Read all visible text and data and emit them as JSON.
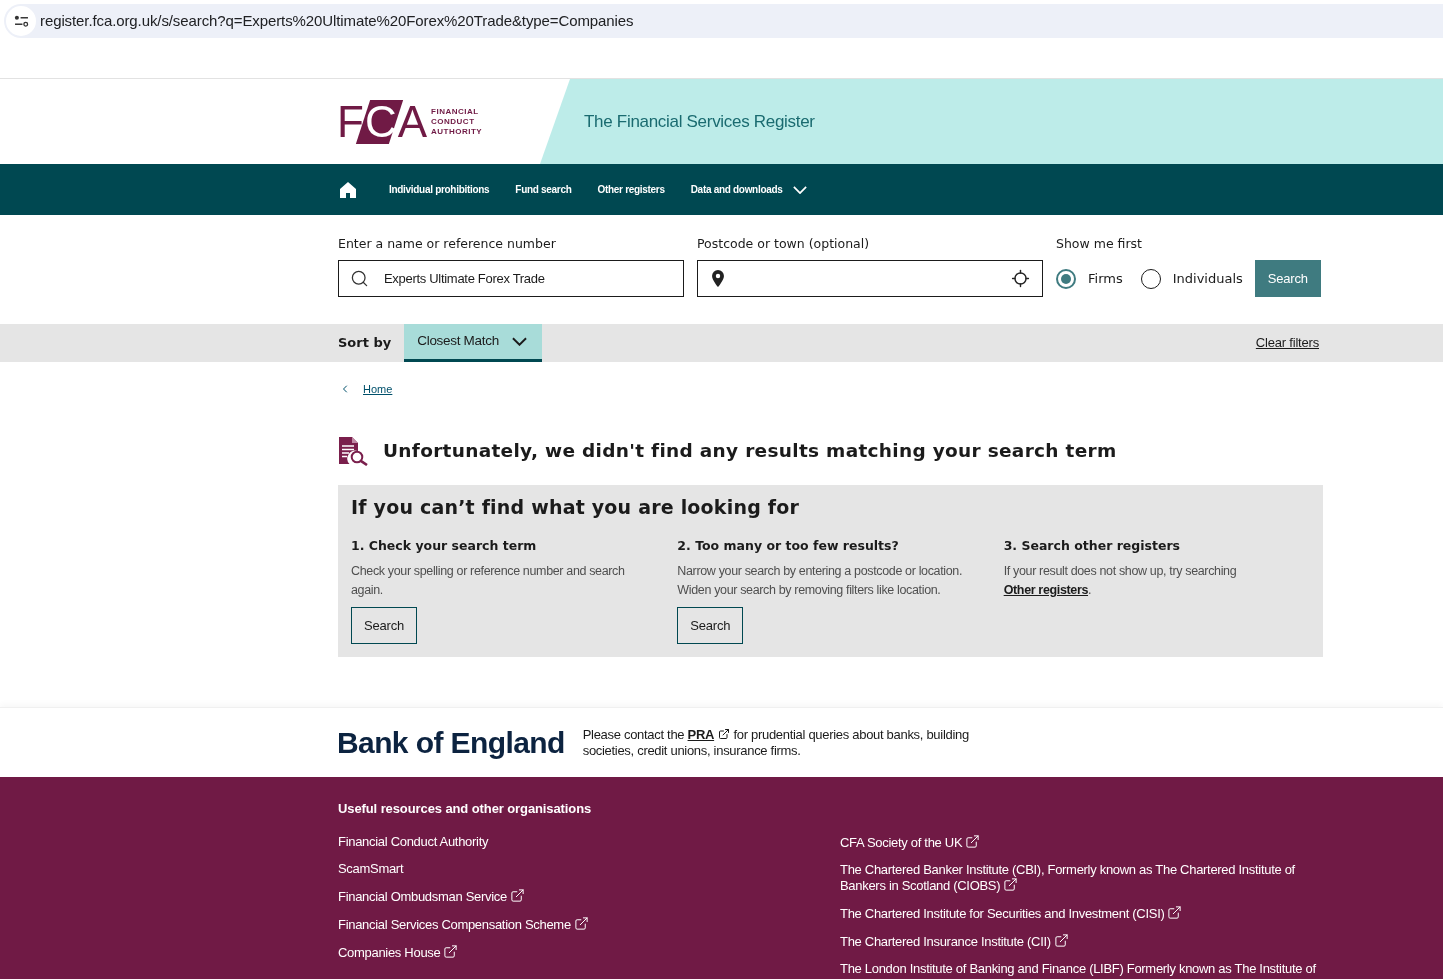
{
  "browser": {
    "url": "register.fca.org.uk/s/search?q=Experts%20Ultimate%20Forex%20Trade&type=Companies"
  },
  "header": {
    "logo": {
      "mark": "FCA",
      "name_lines": [
        "FINANCIAL",
        "CONDUCT",
        "AUTHORITY"
      ]
    },
    "title": "The Financial Services Register"
  },
  "nav": {
    "items": [
      {
        "label": "Individual prohibitions",
        "kind": "link"
      },
      {
        "label": "Fund search",
        "kind": "link"
      },
      {
        "label": "Other registers",
        "kind": "link"
      },
      {
        "label": "Data and downloads",
        "kind": "menu"
      }
    ]
  },
  "search": {
    "name_field": {
      "label": "Enter a name or reference number",
      "value": "Experts Ultimate Forex Trade"
    },
    "location_field": {
      "label": "Postcode or town (optional)"
    },
    "show_first": {
      "label": "Show me first",
      "options": [
        {
          "label": "Firms",
          "selected": true
        },
        {
          "label": "Individuals",
          "selected": false
        }
      ]
    },
    "button": "Search"
  },
  "sort_bar": {
    "label": "Sort by",
    "value": "Closest Match",
    "clear_filters": "Clear filters"
  },
  "breadcrumb": [
    "Home"
  ],
  "no_results": {
    "heading": "Unfortunately, we didn't find any results matching your search term"
  },
  "help_box": {
    "title": "If you can’t find what you are looking for",
    "columns": [
      {
        "heading": "1. Check your search term",
        "text": "Check your spelling or reference number and search again.",
        "button": "Search"
      },
      {
        "heading": "2. Too many or too few results?",
        "text": "Narrow your search by entering a postcode or location. Widen your search by removing filters like location.",
        "button": "Search"
      },
      {
        "heading": "3. Search other registers",
        "text": "If your result does not show up, try searching",
        "link": "Other registers",
        "text_end": "."
      }
    ]
  },
  "bank_of_england": {
    "logo": "Bank of England",
    "text_before": "Please contact the",
    "link": "PRA",
    "text_after": "for prudential queries about banks, building societies, credit unions, insurance firms."
  },
  "footer": {
    "title": "Useful resources and other organisations",
    "columns": [
      [
        {
          "label": "Financial Conduct Authority",
          "kind": "plain"
        },
        {
          "label": "ScamSmart",
          "kind": "plain"
        },
        {
          "label": "Financial Ombudsman Service",
          "kind": "external"
        },
        {
          "label": "Financial Services Compensation Scheme",
          "kind": "external"
        },
        {
          "label": "Companies House",
          "kind": "external"
        }
      ],
      [
        {
          "label": "CFA Society of the UK",
          "kind": "external"
        },
        {
          "label": "The Chartered Banker Institute (CBI), Formerly known as The Chartered Institute of Bankers in Scotland (CIOBS)",
          "kind": "external"
        },
        {
          "label": "The Chartered Institute for Securities and Investment (CISI)",
          "kind": "external"
        },
        {
          "label": "The Chartered Insurance Institute (CII)",
          "kind": "external"
        },
        {
          "label": "The London Institute of Banking and Finance (LIBF) Formerly known as The Institute of",
          "kind": "plain"
        }
      ]
    ]
  }
}
